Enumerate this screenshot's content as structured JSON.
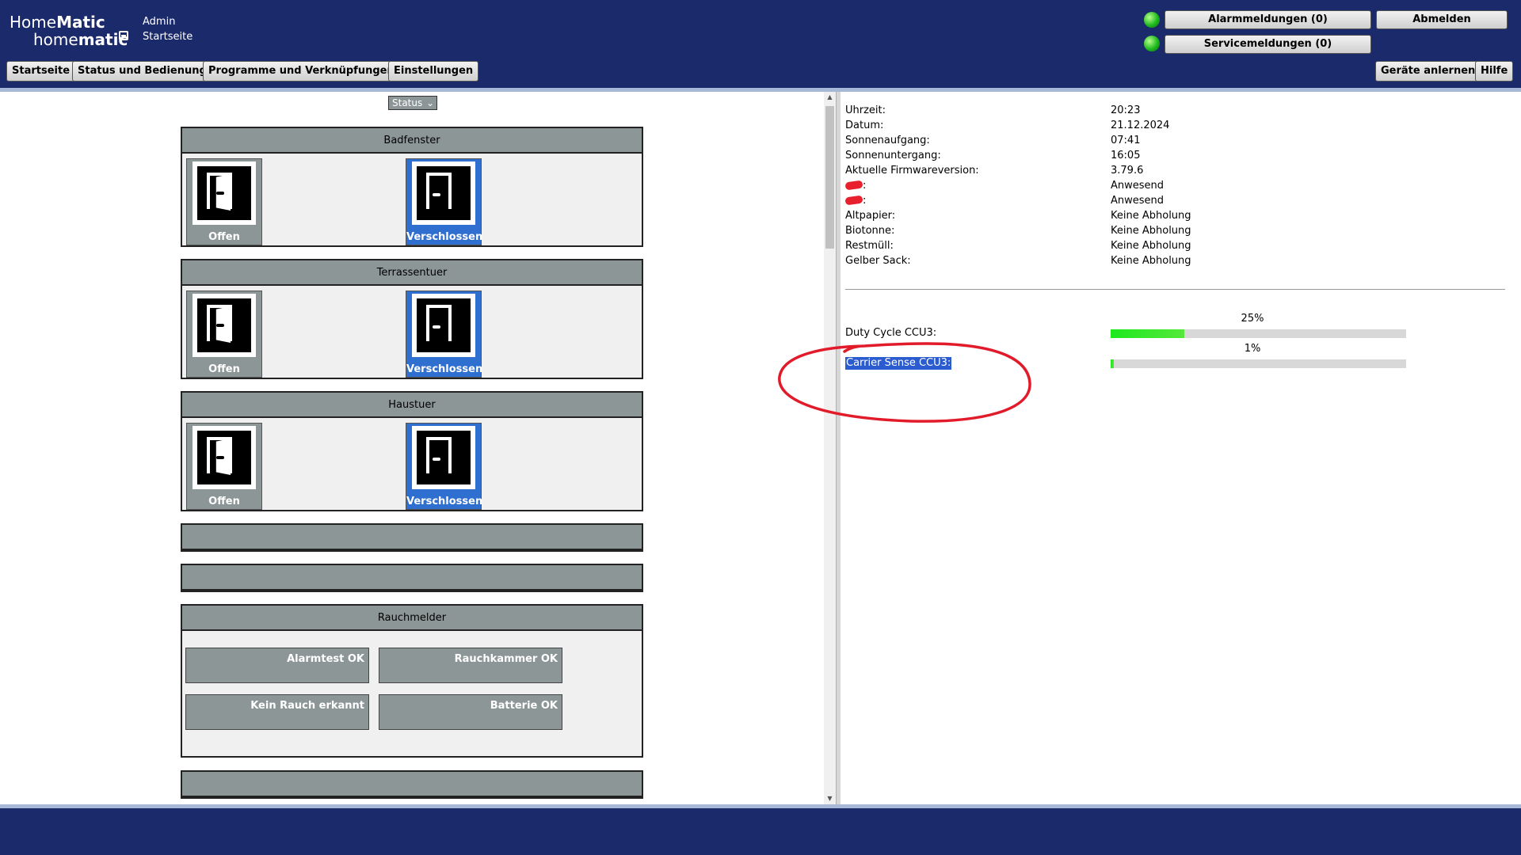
{
  "header": {
    "logo_top_prefix": "Home",
    "logo_top_bold": "Matic",
    "logo_bottom_prefix": "home",
    "logo_bottom_bold": "matic",
    "user": "Admin",
    "page": "Startseite",
    "alarm_button": "Alarmmeldungen (0)",
    "service_button": "Servicemeldungen (0)",
    "logout_button": "Abmelden",
    "teach_button": "Geräte anlernen",
    "help_button": "Hilfe",
    "nav": [
      "Startseite",
      "Status und Bedienung",
      "Programme und Verknüpfungen",
      "Einstellungen"
    ],
    "colors": {
      "bar": "#1b2a6b",
      "led": "#1fb91f"
    }
  },
  "left": {
    "select_value": "Status",
    "groups": [
      {
        "title": "Badfenster",
        "tiles": [
          {
            "label": "Offen",
            "state": "open",
            "icon": "door-open-icon"
          },
          {
            "label": "Verschlossen",
            "state": "closed",
            "icon": "door-closed-icon"
          }
        ]
      },
      {
        "title": "Terrassentuer",
        "tiles": [
          {
            "label": "Offen",
            "state": "open",
            "icon": "door-open-icon"
          },
          {
            "label": "Verschlossen",
            "state": "closed",
            "icon": "door-closed-icon"
          }
        ]
      },
      {
        "title": "Haustuer",
        "tiles": [
          {
            "label": "Offen",
            "state": "open",
            "icon": "door-open-icon"
          },
          {
            "label": "Verschlossen",
            "state": "closed",
            "icon": "door-closed-icon"
          }
        ]
      }
    ],
    "smoke": {
      "title": "Rauchmelder",
      "buttons": [
        "Alarmtest OK",
        "Rauchkammer OK",
        "Kein Rauch erkannt",
        "Batterie OK"
      ]
    }
  },
  "right": {
    "info": [
      {
        "key": "Uhrzeit:",
        "value": "20:23"
      },
      {
        "key": "Datum:",
        "value": "21.12.2024"
      },
      {
        "key": "Sonnenaufgang:",
        "value": "07:41"
      },
      {
        "key": "Sonnenuntergang:",
        "value": "16:05"
      },
      {
        "key": "Aktuelle Firmwareversion:",
        "value": "3.79.6"
      },
      {
        "key": ":",
        "value": "Anwesend",
        "redacted": true
      },
      {
        "key": ":",
        "value": "Anwesend",
        "redacted": true
      },
      {
        "key": "Altpapier:",
        "value": "Keine Abholung"
      },
      {
        "key": "Biotonne:",
        "value": "Keine Abholung"
      },
      {
        "key": "Restmüll:",
        "value": "Keine Abholung"
      },
      {
        "key": "Gelber Sack:",
        "value": "Keine Abholung"
      }
    ],
    "duty_cycle": {
      "label": "Duty Cycle CCU3:",
      "percent_text": "25%",
      "fraction": 0.25
    },
    "carrier_sense": {
      "label": "Carrier Sense CCU3:",
      "percent_text": "1%",
      "fraction": 0.01
    }
  }
}
